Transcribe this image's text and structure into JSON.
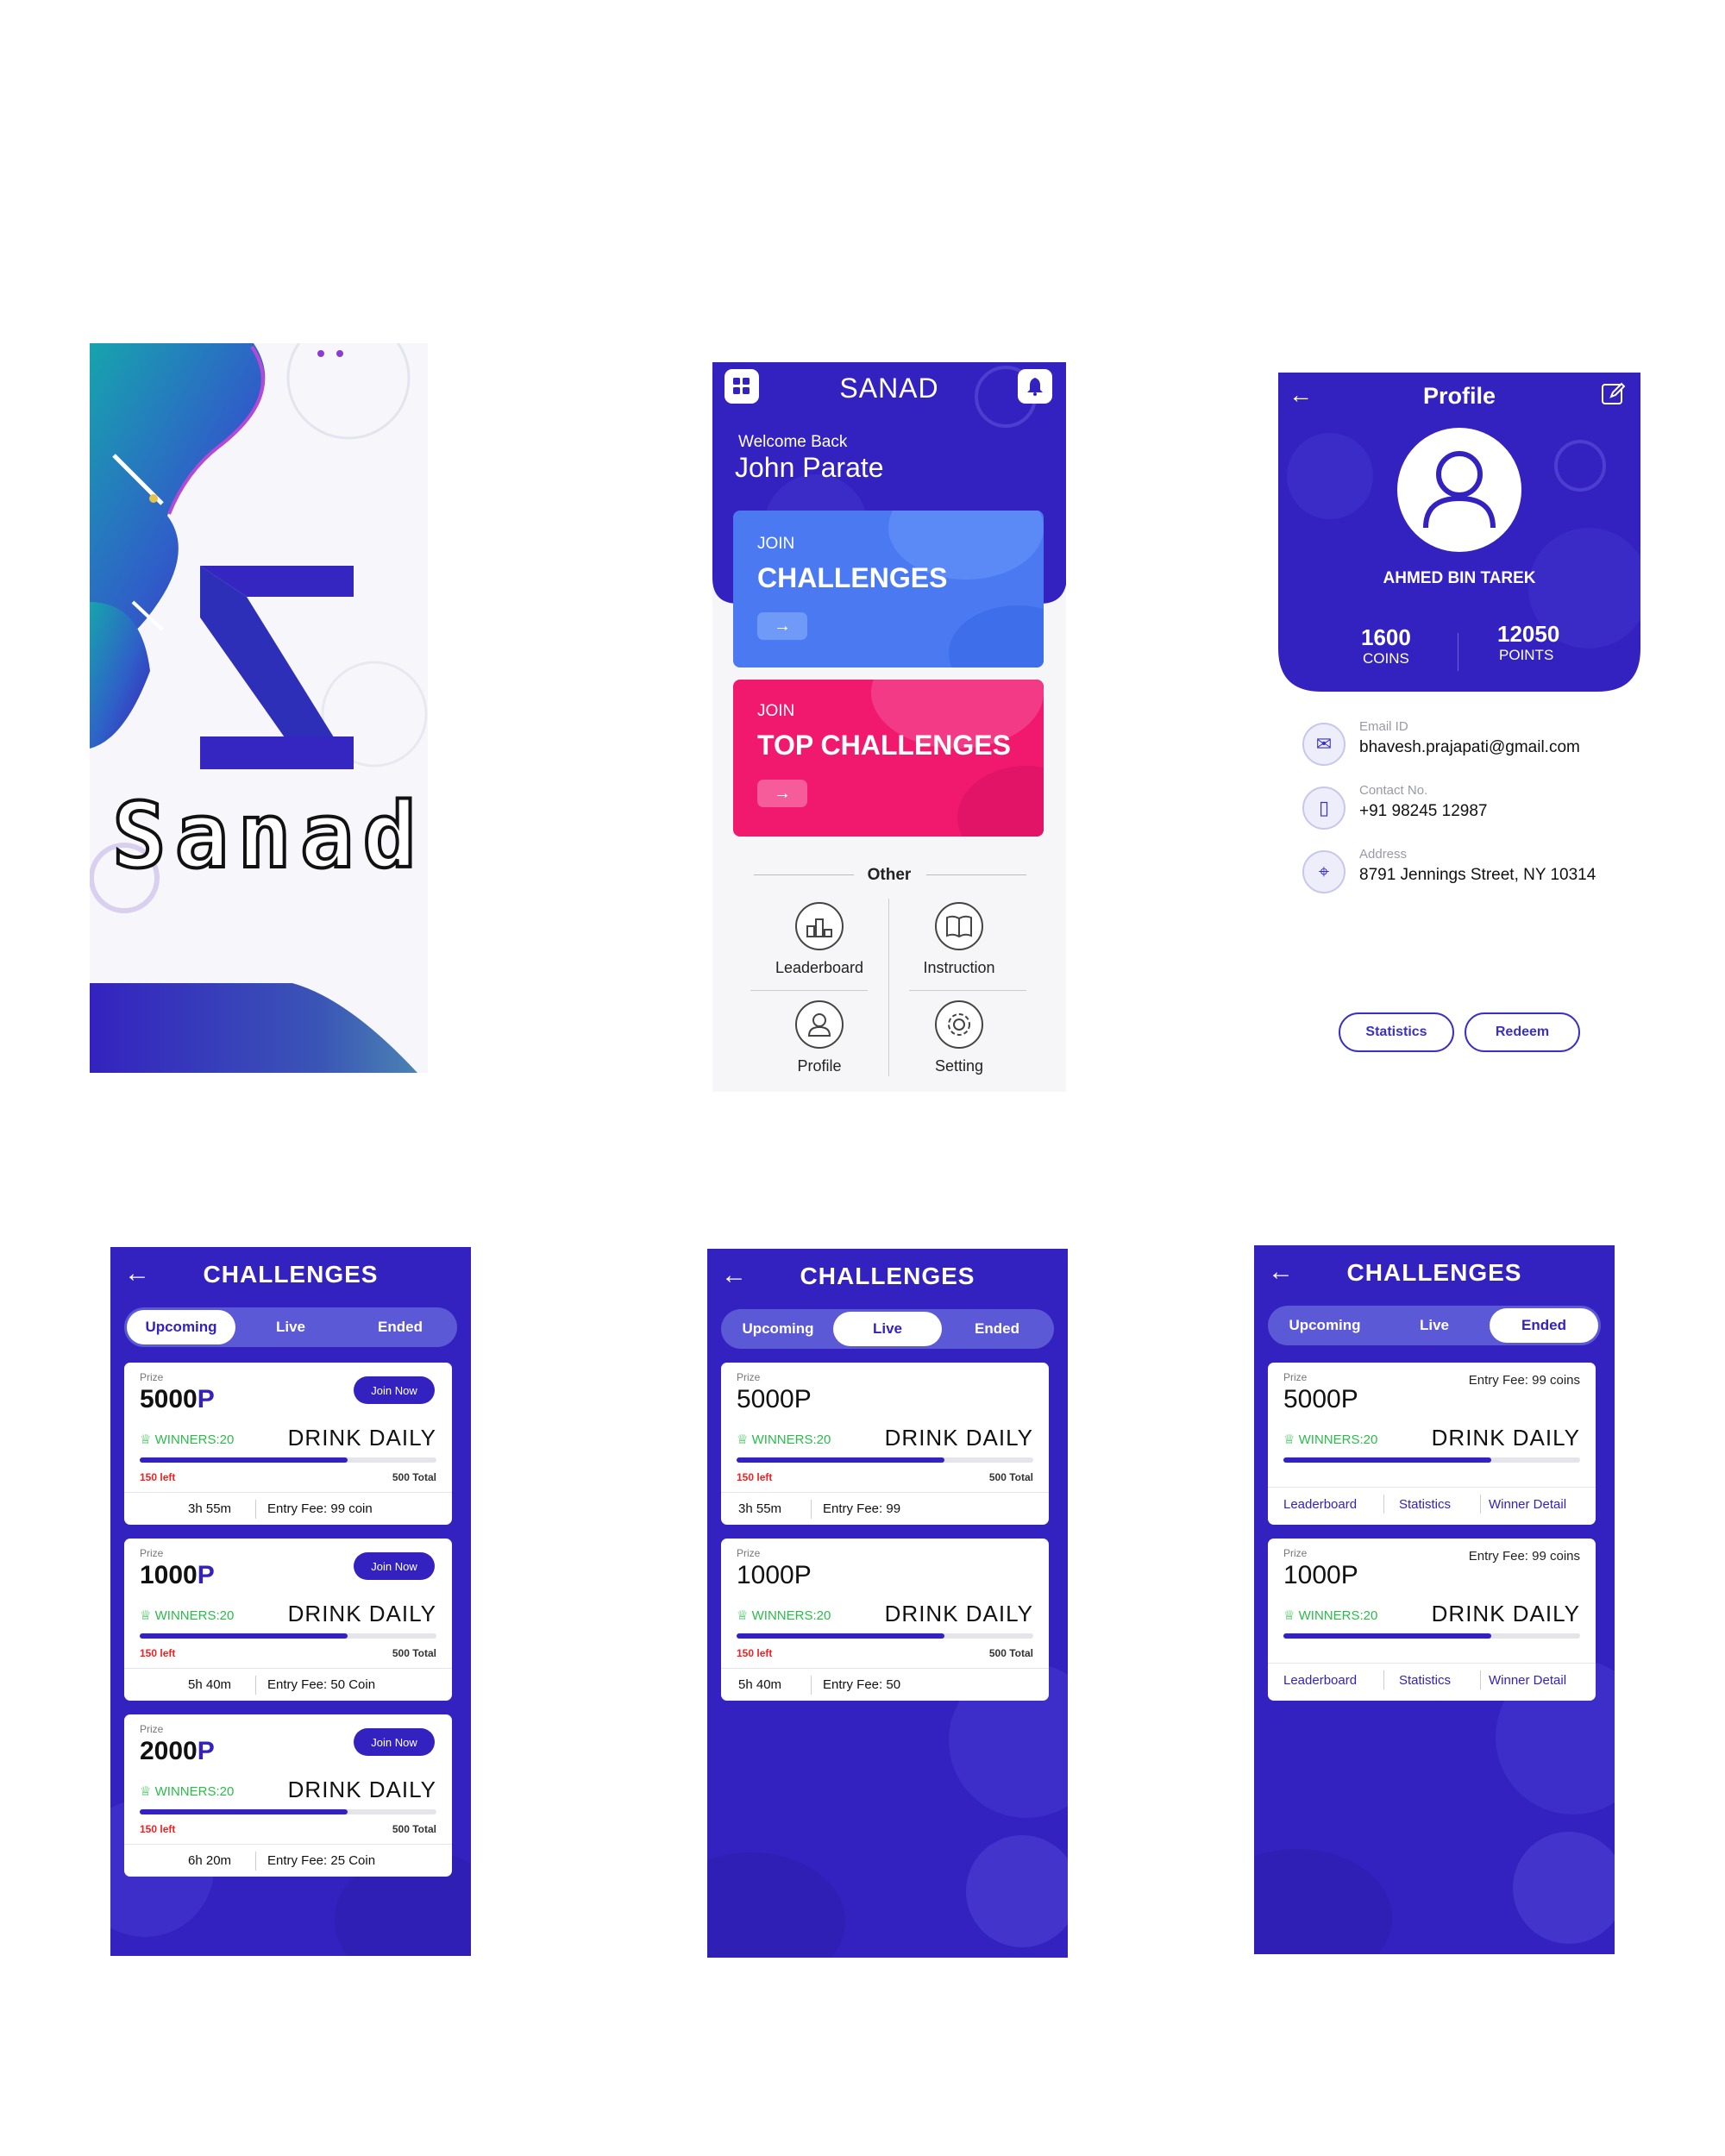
{
  "splash": {
    "wordmark": "Sanad"
  },
  "home": {
    "app_title": "SANAD",
    "welcome": "Welcome Back",
    "user_name": "John Parate",
    "card1": {
      "join": "JOIN",
      "title": "CHALLENGES",
      "arrow": "→"
    },
    "card2": {
      "join": "JOIN",
      "title": "TOP CHALLENGES",
      "arrow": "→"
    },
    "other_label": "Other",
    "tiles": [
      "Leaderboard",
      "Instruction",
      "Profile",
      "Setting"
    ]
  },
  "profile": {
    "title": "Profile",
    "name": "AHMED BIN TAREK",
    "coins_value": "1600",
    "coins_label": "COINS",
    "points_value": "12050",
    "points_label": "POINTS",
    "email_label": "Email ID",
    "email": "bhavesh.prajapati@gmail.com",
    "contact_label": "Contact No.",
    "contact": "+91 98245 12987",
    "address_label": "Address",
    "address": "8791 Jennings Street, NY 10314",
    "btn_statistics": "Statistics",
    "btn_redeem": "Redeem"
  },
  "challenges": {
    "title": "CHALLENGES",
    "tabs": [
      "Upcoming",
      "Live",
      "Ended"
    ],
    "upcoming": [
      {
        "prize_label": "Prize",
        "amount": "5000",
        "unit": "P",
        "join": "Join Now",
        "winners": "WINNERS:20",
        "name": "DRINK DAILY",
        "left": "150 left",
        "total": "500 Total",
        "time": "3h 55m",
        "fee": "Entry Fee: 99 coin",
        "progress": 0.7
      },
      {
        "prize_label": "Prize",
        "amount": "1000",
        "unit": "P",
        "join": "Join Now",
        "winners": "WINNERS:20",
        "name": "DRINK DAILY",
        "left": "150 left",
        "total": "500 Total",
        "time": "5h 40m",
        "fee": "Entry Fee: 50 Coin",
        "progress": 0.7
      },
      {
        "prize_label": "Prize",
        "amount": "2000",
        "unit": "P",
        "join": "Join Now",
        "winners": "WINNERS:20",
        "name": "DRINK DAILY",
        "left": "150 left",
        "total": "500 Total",
        "time": "6h 20m",
        "fee": "Entry Fee: 25 Coin",
        "progress": 0.7
      }
    ],
    "live": [
      {
        "prize_label": "Prize",
        "amount": "5000",
        "unit": "P",
        "winners": "WINNERS:20",
        "name": "DRINK DAILY",
        "left": "150 left",
        "total": "500 Total",
        "time": "3h 55m",
        "fee": "Entry Fee: 99",
        "progress": 0.7
      },
      {
        "prize_label": "Prize",
        "amount": "1000",
        "unit": "P",
        "winners": "WINNERS:20",
        "name": "DRINK DAILY",
        "left": "150 left",
        "total": "500 Total",
        "time": "5h 40m",
        "fee": "Entry Fee: 50",
        "progress": 0.7
      }
    ],
    "ended": [
      {
        "prize_label": "Prize",
        "amount": "5000",
        "unit": "P",
        "fee": "Entry Fee: 99 coins",
        "winners": "WINNERS:20",
        "name": "DRINK DAILY",
        "progress": 0.7,
        "links": [
          "Leaderboard",
          "Statistics",
          "Winner Detail"
        ]
      },
      {
        "prize_label": "Prize",
        "amount": "1000",
        "unit": "P",
        "fee": "Entry Fee: 99 coins",
        "winners": "WINNERS:20",
        "name": "DRINK DAILY",
        "progress": 0.7,
        "links": [
          "Leaderboard",
          "Statistics",
          "Winner Detail"
        ]
      }
    ]
  },
  "colors": {
    "primary": "#3322C0",
    "pink": "#F0196E",
    "blue_card": "#4A79F2",
    "teal": "#1E9AB0",
    "green": "#2BBB4A",
    "red": "#E22222"
  },
  "icons": [
    "grid-icon",
    "bell-icon",
    "back-arrow-icon",
    "edit-icon",
    "user-icon",
    "mail-icon",
    "phone-icon",
    "location-icon",
    "trophy-icon",
    "leaderboard-icon",
    "book-icon",
    "person-icon",
    "gear-icon"
  ]
}
